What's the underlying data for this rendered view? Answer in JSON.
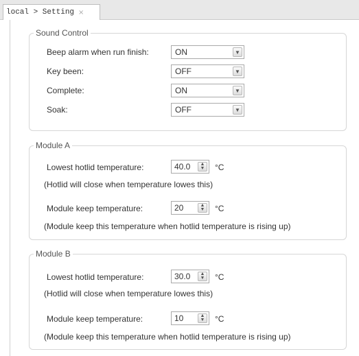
{
  "tab": {
    "title": "local > Setting",
    "close_glyph": "×"
  },
  "sound_control": {
    "legend": "Sound Control",
    "rows": [
      {
        "label": "Beep alarm when run finish:",
        "value": "ON"
      },
      {
        "label": "Key been:",
        "value": "OFF"
      },
      {
        "label": "Complete:",
        "value": "ON"
      },
      {
        "label": "Soak:",
        "value": "OFF"
      }
    ]
  },
  "module_a": {
    "legend": "Module A",
    "hotlid_label": "Lowest hotlid temperature:",
    "hotlid_value": "40.0",
    "hotlid_unit": "°C",
    "hotlid_note": "(Hotlid will close when temperature lowes this)",
    "keep_label": "Module keep temperature:",
    "keep_value": "20",
    "keep_unit": "°C",
    "keep_note": "(Module keep this temperature when hotlid temperature is rising up)"
  },
  "module_b": {
    "legend": "Module B",
    "hotlid_label": "Lowest hotlid temperature:",
    "hotlid_value": "30.0",
    "hotlid_unit": "°C",
    "hotlid_note": "(Hotlid will close when temperature lowes this)",
    "keep_label": "Module keep temperature:",
    "keep_value": "10",
    "keep_unit": "°C",
    "keep_note": "(Module keep this temperature when hotlid temperature is  rising up)"
  },
  "icons": {
    "dropdown": "chevron-down-icon",
    "spinner": "spinner-arrows-icon",
    "close": "close-icon"
  }
}
